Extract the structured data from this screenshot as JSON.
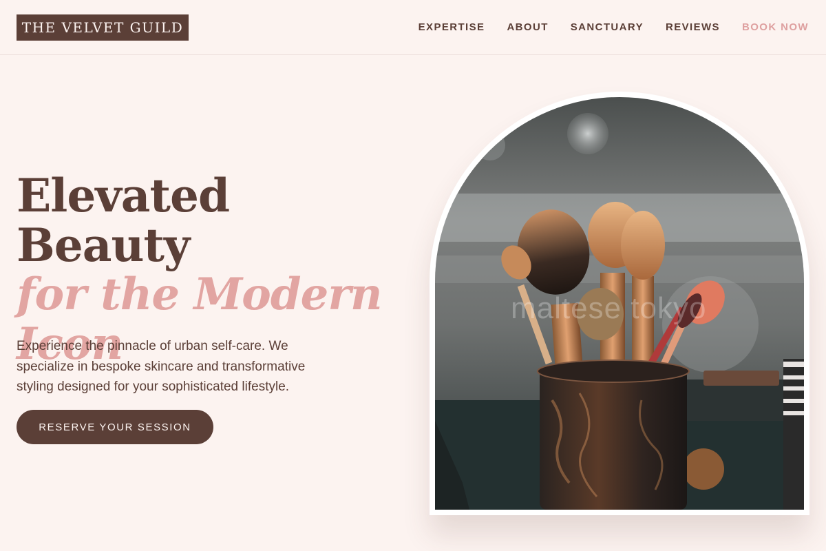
{
  "header": {
    "logo": "THE VELVET GUILD",
    "nav": [
      {
        "label": "EXPERTISE"
      },
      {
        "label": "ABOUT"
      },
      {
        "label": "SANCTUARY"
      },
      {
        "label": "REVIEWS"
      },
      {
        "label": "BOOK NOW"
      }
    ]
  },
  "hero": {
    "title_line1": "Elevated Beauty",
    "title_line2": "for the Modern",
    "title_line3": "Icon",
    "description": "Experience the pinnacle of urban self-care. We specialize in bespoke skincare and transformative styling designed for your sophisticated lifestyle.",
    "cta_label": "RESERVE YOUR SESSION",
    "image_watermark": "maltese tokyo"
  },
  "colors": {
    "background": "#fcf3f0",
    "primary": "#5b3f37",
    "accent": "#e2a5a2",
    "nav_highlight": "#dea0a0"
  },
  "icons": {
    "hero_image": "makeup-brushes-photo"
  }
}
